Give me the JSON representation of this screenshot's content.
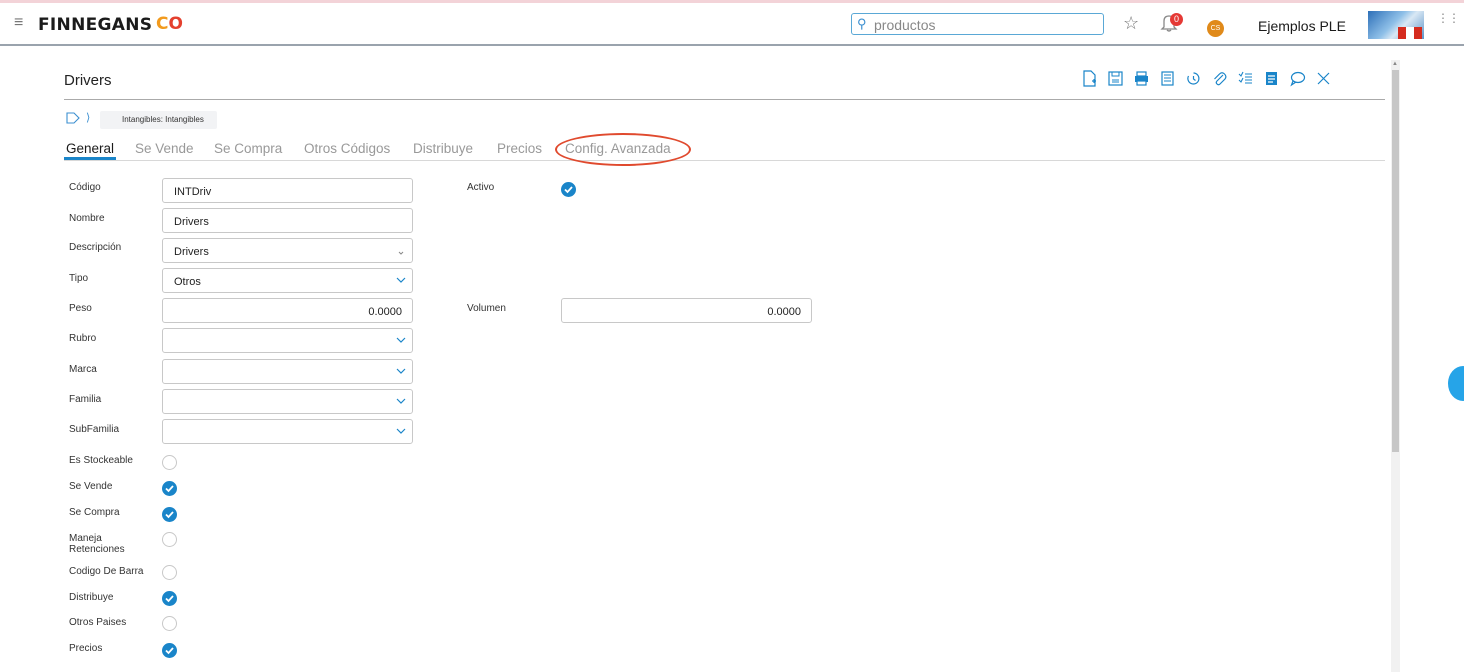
{
  "topbar": {
    "logo_text": "FINNEGANS",
    "logo_mark_1": "C",
    "logo_mark_2": "O",
    "search_value": "productos",
    "notification_count": "0",
    "avatar_initials": "CS",
    "company": "Ejemplos PLE"
  },
  "page": {
    "title": "Drivers",
    "breadcrumb": "Intangibles: Intangibles"
  },
  "toolbar": {
    "icons": [
      "new-document-icon",
      "save-icon",
      "print-icon",
      "document-icon",
      "history-icon",
      "attach-icon",
      "checklist-icon",
      "notes-icon",
      "comment-icon",
      "close-icon"
    ]
  },
  "tabs": [
    {
      "label": "General",
      "active": true
    },
    {
      "label": "Se Vende"
    },
    {
      "label": "Se Compra"
    },
    {
      "label": "Otros Códigos"
    },
    {
      "label": "Distribuye"
    },
    {
      "label": "Precios"
    },
    {
      "label": "Config. Avanzada",
      "highlighted": true
    }
  ],
  "form": {
    "codigo": {
      "label": "Código",
      "value": "INTDriv"
    },
    "nombre": {
      "label": "Nombre",
      "value": "Drivers"
    },
    "descripcion": {
      "label": "Descripción",
      "value": "Drivers"
    },
    "tipo": {
      "label": "Tipo",
      "value": "Otros"
    },
    "peso": {
      "label": "Peso",
      "value": "0.0000"
    },
    "rubro": {
      "label": "Rubro",
      "value": ""
    },
    "marca": {
      "label": "Marca",
      "value": ""
    },
    "familia": {
      "label": "Familia",
      "value": ""
    },
    "subfamilia": {
      "label": "SubFamilia",
      "value": ""
    },
    "activo": {
      "label": "Activo",
      "checked": true
    },
    "volumen": {
      "label": "Volumen",
      "value": "0.0000"
    },
    "es_stockeable": {
      "label": "Es Stockeable",
      "checked": false
    },
    "se_vende": {
      "label": "Se Vende",
      "checked": true
    },
    "se_compra": {
      "label": "Se Compra",
      "checked": true
    },
    "maneja_retenciones": {
      "label_1": "Maneja",
      "label_2": "Retenciones",
      "checked": false
    },
    "codigo_de_barra": {
      "label": "Codigo De Barra",
      "checked": false
    },
    "distribuye": {
      "label": "Distribuye",
      "checked": true
    },
    "otros_paises": {
      "label": "Otros Paises",
      "checked": false
    },
    "precios": {
      "label": "Precios",
      "checked": true
    }
  },
  "colors": {
    "accent": "#1a85c9",
    "highlight_circle": "#e04a2e",
    "avatar": "#e08a1a"
  }
}
